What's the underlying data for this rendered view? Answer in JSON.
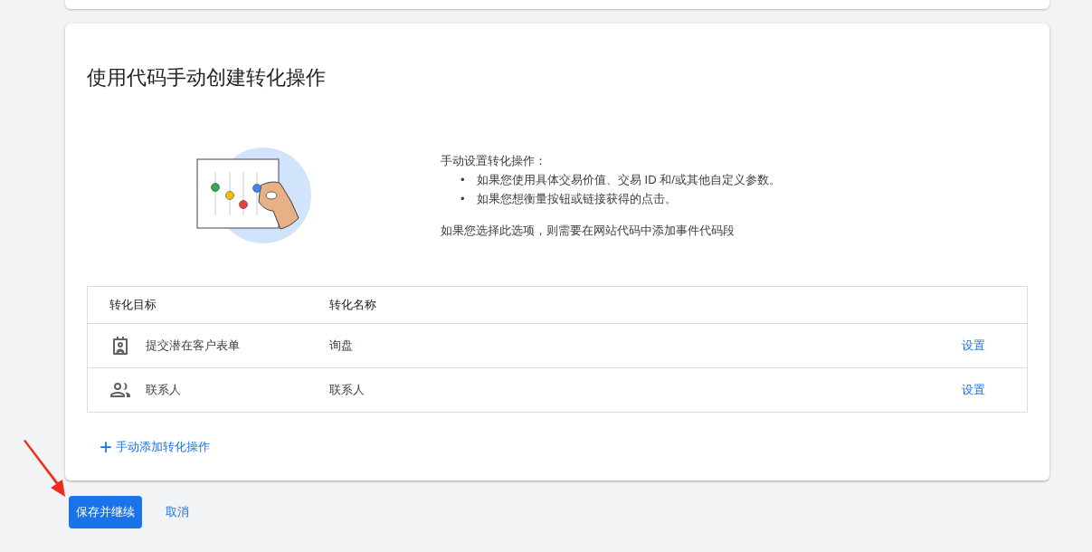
{
  "card": {
    "title": "使用代码手动创建转化操作",
    "intro": "手动设置转化操作：",
    "bullets": [
      {
        "marker": "•",
        "text": "如果您使用具体交易价值、交易 ID 和/或其他自定义参数。"
      },
      {
        "marker": "•",
        "text": "如果您想衡量按钮或链接获得的点击。"
      }
    ],
    "note": "如果您选择此选项，则需要在网站代码中添加事件代码段"
  },
  "table": {
    "columns": [
      "转化目标",
      "转化名称"
    ],
    "rows": [
      {
        "kind": "form",
        "goal": "提交潜在客户表单",
        "name": "询盘",
        "action": "设置"
      },
      {
        "kind": "contacts",
        "goal": "联系人",
        "name": "联系人",
        "action": "设置"
      }
    ]
  },
  "add_link": {
    "icon": "+",
    "label": "手动添加转化操作"
  },
  "buttons": {
    "primary": "保存并继续",
    "secondary": "取消"
  }
}
